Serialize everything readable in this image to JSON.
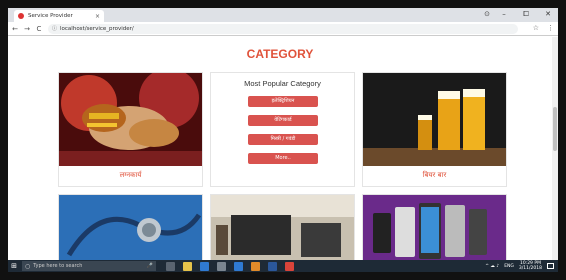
{
  "browser": {
    "tab_title": "Service Provider",
    "tab_close": "×",
    "profile_icon": "⊙",
    "win_minimize": "–",
    "win_restore": "⧠",
    "win_close": "✕",
    "back": "←",
    "forward": "→",
    "reload": "C",
    "url_icon": "ⓘ",
    "url": "localhost/service_provider/",
    "star": "☆",
    "menu": "⋮"
  },
  "page": {
    "heading": "CATEGORY",
    "cards": [
      {
        "label": "लग्नकार्य"
      },
      {
        "label": "बियर बार"
      }
    ],
    "popular": {
      "title": "Most Popular Category",
      "buttons": [
        "इलेक्ट्रिशियन",
        "वेटिंगकार्ड",
        "मिस्त्री / गवंडी",
        "More.."
      ]
    }
  },
  "taskbar": {
    "start_icon": "⊞",
    "search_placeholder": "Type here to search",
    "search_icon": "○",
    "mic_icon": "🎤",
    "lang": "ENG",
    "time": "10:29 PM",
    "date": "3/11/2018",
    "tray_icons": "^ ☁ ♪"
  },
  "colors": {
    "accent": "#e0533b",
    "button": "#d9534f",
    "taskbar": "#1e2a36"
  }
}
